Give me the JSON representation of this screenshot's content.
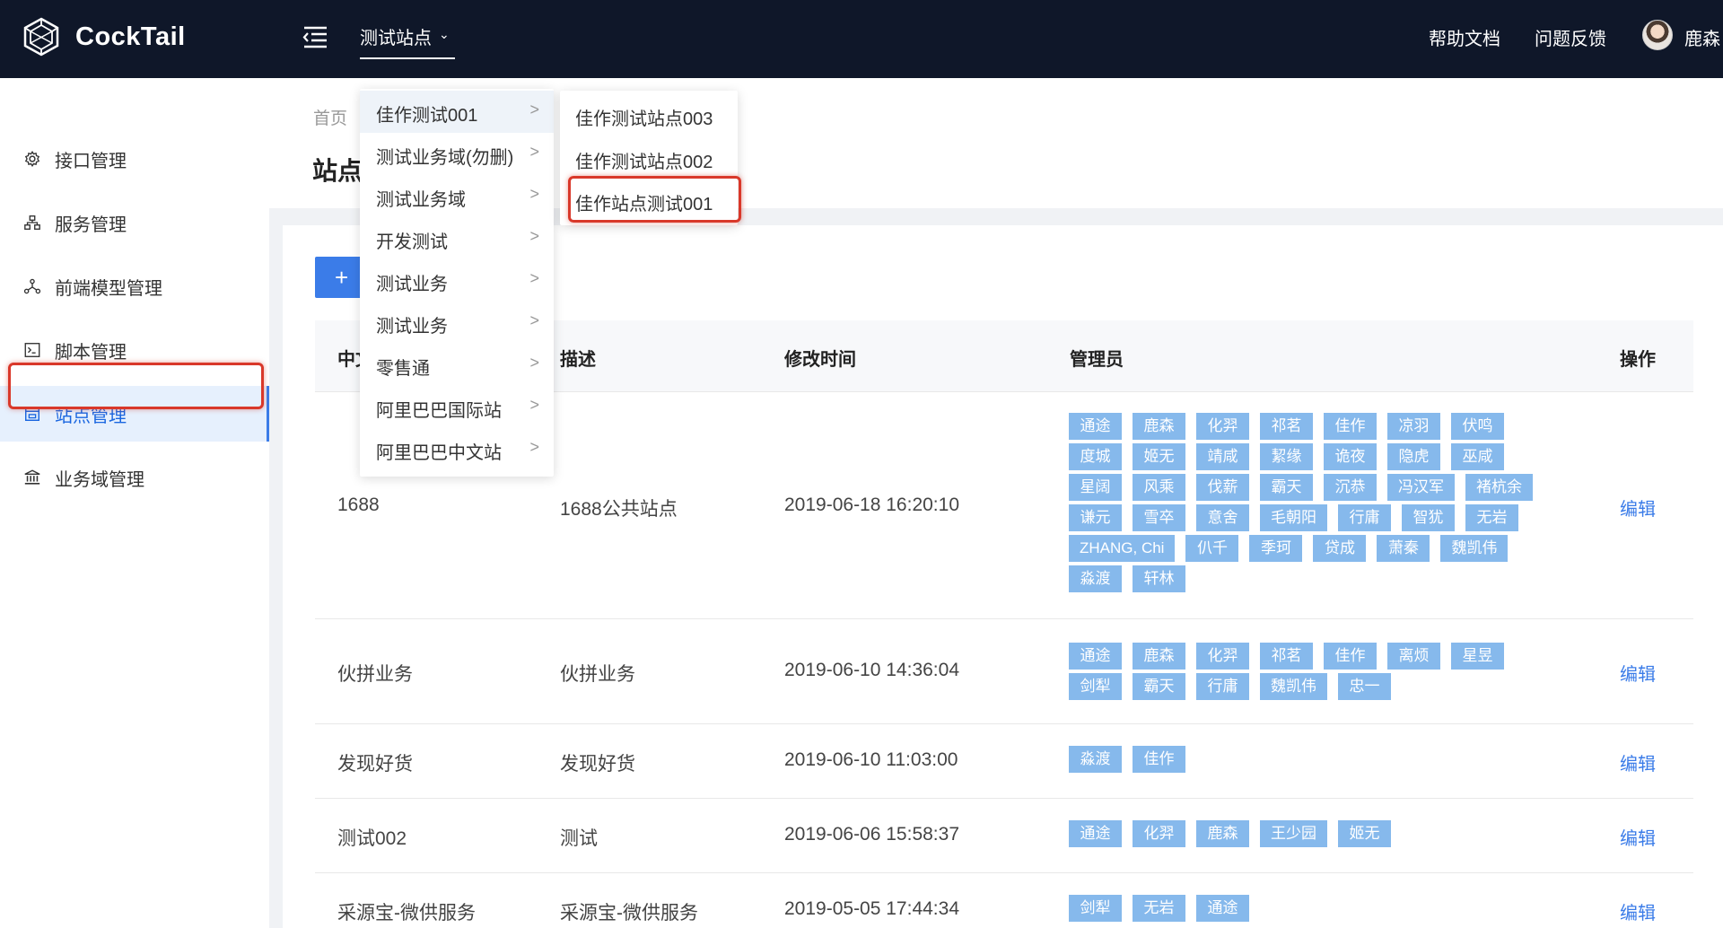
{
  "header": {
    "logo_text": "CockTail",
    "site_select": "测试站点",
    "links": [
      "帮助文档",
      "问题反馈"
    ],
    "user_name": "鹿森"
  },
  "sidebar": {
    "items": [
      {
        "label": "接口管理",
        "icon": "gear-icon"
      },
      {
        "label": "服务管理",
        "icon": "sitemap-icon"
      },
      {
        "label": "前端模型管理",
        "icon": "nodes-icon"
      },
      {
        "label": "脚本管理",
        "icon": "terminal-icon"
      },
      {
        "label": "站点管理",
        "icon": "store-icon",
        "active": true
      },
      {
        "label": "业务域管理",
        "icon": "bank-icon"
      }
    ]
  },
  "page": {
    "breadcrumb": "首页",
    "title": "站点",
    "add_button": "+"
  },
  "table": {
    "headers": [
      "中文",
      "描述",
      "修改时间",
      "管理员",
      "操作"
    ],
    "edit_label": "编辑",
    "rows": [
      {
        "name": "1688",
        "desc": "1688公共站点",
        "time": "2019-06-18 16:20:10",
        "admins": [
          "通途",
          "鹿森",
          "化羿",
          "祁茗",
          "佳作",
          "凉羽",
          "伏鸣",
          "度城",
          "姬无",
          "靖咸",
          "絜缘",
          "诡夜",
          "隐虎",
          "巫咸",
          "星阔",
          "风乘",
          "伐薪",
          "霸天",
          "沉恭",
          "冯汉军",
          "褚杭余",
          "谦元",
          "雪卒",
          "意舍",
          "毛朝阳",
          "行庸",
          "智犹",
          "无岩",
          "ZHANG, Chi",
          "仈千",
          "季珂",
          "贷成",
          "萧秦",
          "魏凯伟",
          "淼渡",
          "轩林"
        ]
      },
      {
        "name": "伙拼业务",
        "desc": "伙拼业务",
        "time": "2019-06-10 14:36:04",
        "admins": [
          "通途",
          "鹿森",
          "化羿",
          "祁茗",
          "佳作",
          "离烦",
          "星昱",
          "剑犁",
          "霸天",
          "行庸",
          "魏凯伟",
          "忠一"
        ]
      },
      {
        "name": "发现好货",
        "desc": "发现好货",
        "time": "2019-06-10 11:03:00",
        "admins": [
          "淼渡",
          "佳作"
        ]
      },
      {
        "name": "测试002",
        "desc": "测试",
        "time": "2019-06-06 15:58:37",
        "admins": [
          "通途",
          "化羿",
          "鹿森",
          "王少园",
          "姬无"
        ]
      },
      {
        "name": "采源宝-微供服务",
        "desc": "采源宝-微供服务",
        "time": "2019-05-05 17:44:34",
        "admins": [
          "剑犁",
          "无岩",
          "通途"
        ]
      }
    ]
  },
  "dropdown": {
    "level1": [
      "佳作测试001",
      "测试业务域(勿删)",
      "测试业务域",
      "开发测试",
      "测试业务",
      "测试业务",
      "零售通",
      "阿里巴巴国际站",
      "阿里巴巴中文站"
    ],
    "level2": [
      "佳作测试站点003",
      "佳作测试站点002",
      "佳作站点测试001"
    ]
  }
}
